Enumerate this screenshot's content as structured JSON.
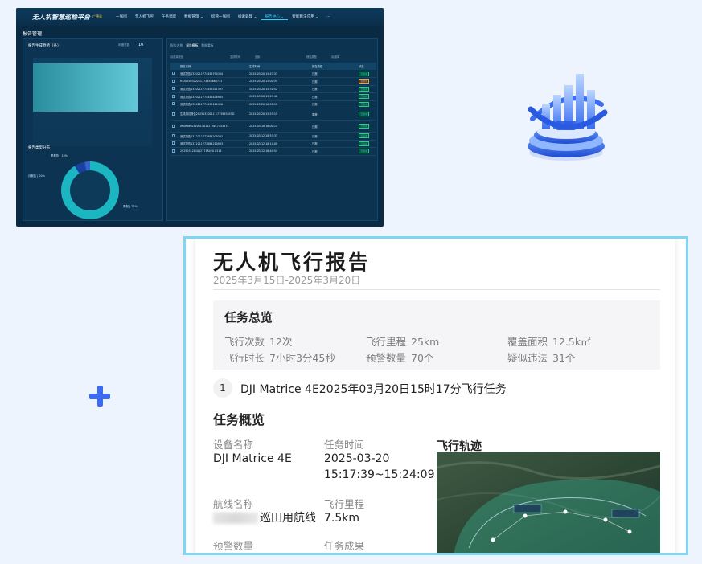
{
  "dashboard": {
    "brand": "无人机智慧巡检平台",
    "brand_tag": "广德县",
    "nav": [
      "一张图",
      "无人机飞控",
      "任务调度",
      "数据管理 ⌄",
      "综管一张图",
      "线索处理 ⌄",
      "报告中心 ⌄",
      "智能算法应用 ⌄",
      "···"
    ],
    "active_nav": "报告中心 ⌄",
    "page_title": "报告管理",
    "trend_title": "报告生成趋势（条）",
    "trend_filter": "年度总数",
    "trend_total": "10",
    "dist_title": "报告类型分布",
    "donut_labels": [
      "季报告 | 10%",
      "月报告 | 20%",
      "周报 | 70%"
    ],
    "tabs": [
      "报告名称",
      "报告模板",
      "数据看板"
    ],
    "active_tab": "报告模板",
    "filters": [
      "请选择报告",
      "生成时间",
      "全部",
      "报告类型",
      "请选择"
    ],
    "table": {
      "headers": [
        "",
        "报告名称",
        "生成时间",
        "报告类型",
        "状态"
      ],
      "rows": [
        [
          "测试报告0320211774455794384",
          "2025-03-20 15:43:33",
          "日报",
          "已完成"
        ],
        [
          "rrr20250320211774456660733",
          "2025-03-20 15:00:54",
          "日报",
          "生成中"
        ],
        [
          "测试报告0320211774455521397",
          "2025-03-20 15:31:52",
          "日报",
          "已完成"
        ],
        [
          "测试报告0320211774455428905",
          "2025-03-20 15:29:40",
          "日报",
          "已完成"
        ],
        [
          "测试报告0320211774455102456",
          "2025-03-20 16:51:11",
          "日报",
          "已完成"
        ],
        [
          "生成测试报告20250320211 1775955455D",
          "2025-03-20 15:53:15",
          "周报",
          "已完成"
        ],
        [
          "reviewer0320011811273617453874",
          "2025-03-18 16:00:14",
          "日报",
          "已完成"
        ],
        [
          "测试报告0312211772884208362",
          "2025-03-12 18:57:33",
          "月报",
          "已完成"
        ],
        [
          "测试报告0312211772884210983",
          "2025-03-12 18:14:09",
          "日报",
          "已完成"
        ],
        [
          "20250312010127718420 0318",
          "2025-03-12 16:44:54",
          "日报",
          "已完成"
        ]
      ]
    }
  },
  "report": {
    "title": "无人机飞行报告",
    "date_range": "2025年3月15日-2025年3月20日",
    "summary_title": "任务总览",
    "stats": [
      {
        "label": "飞行次数",
        "value": "12次"
      },
      {
        "label": "飞行里程",
        "value": "25km"
      },
      {
        "label": "覆盖面积",
        "value": "12.5k㎡"
      },
      {
        "label": "飞行时长",
        "value": "7小时3分45秒"
      },
      {
        "label": "预警数量",
        "value": "70个"
      },
      {
        "label": "疑似违法",
        "value": "31个"
      }
    ],
    "mission_no": "1",
    "mission_title": "DJI Matrice 4E2025年03月20日15时17分飞行任务",
    "overview_title": "任务概览",
    "device_label": "设备名称",
    "device_value": "DJI Matrice 4E",
    "time_label": "任务时间",
    "time_value_1": "2025-03-20",
    "time_value_2": "15:17:39~15:24:09",
    "route_label": "航线名称",
    "route_value": "巡田用航线",
    "distance_label": "飞行里程",
    "distance_value": "7.5km",
    "warning_label": "预警数量",
    "result_label": "任务成果",
    "track_title": "飞行轨迹"
  },
  "colors": {
    "accent": "#3d6bf0",
    "frame": "#7fd6f4",
    "dash_bg": "#0a2a44",
    "badge_ok": "#27d27f",
    "badge_warn": "#ff9b3a"
  }
}
